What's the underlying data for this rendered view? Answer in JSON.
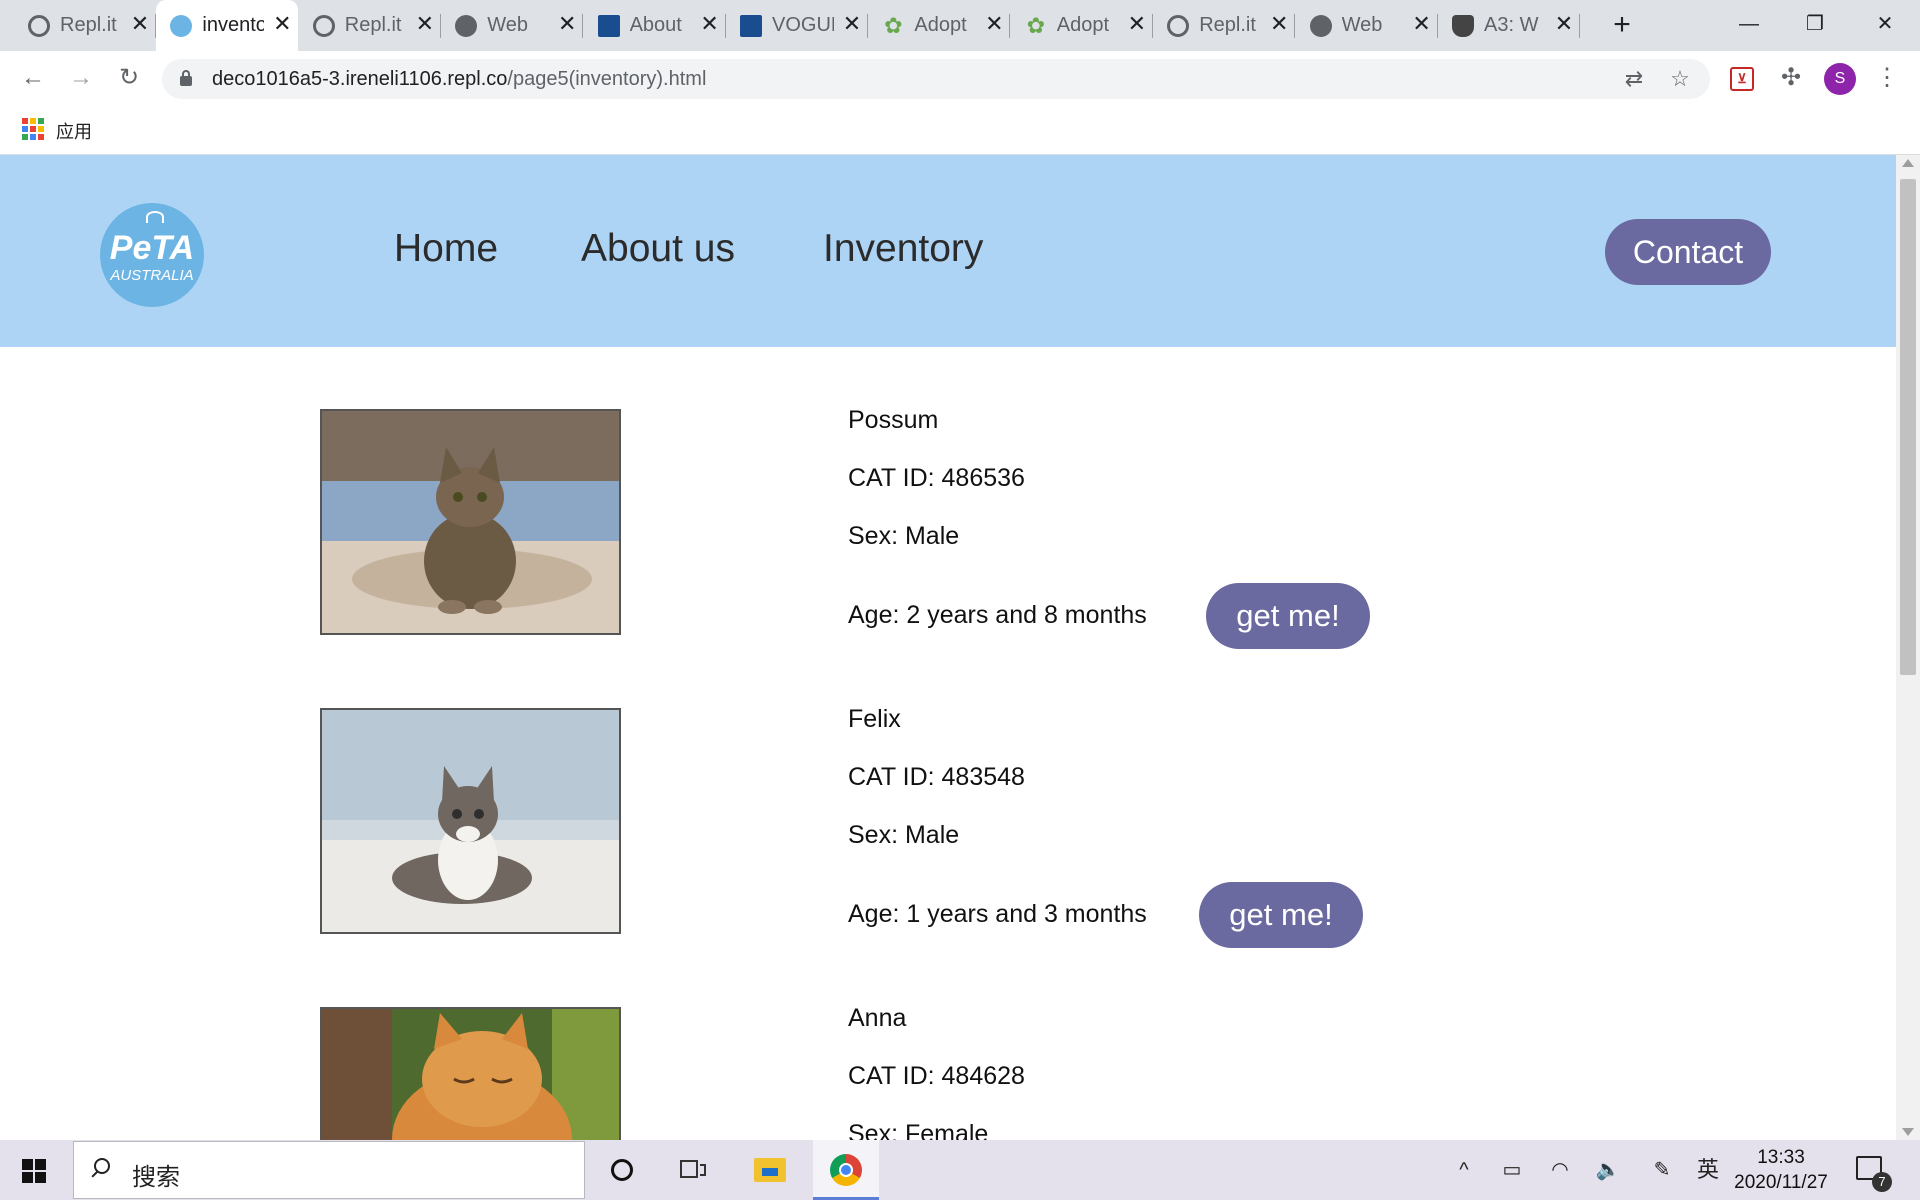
{
  "tabs": [
    {
      "title": "Repl.it",
      "favicon": "replit-icon",
      "active": false
    },
    {
      "title": "inventory",
      "favicon": "peta-favicon-icon",
      "active": true
    },
    {
      "title": "Repl.it",
      "favicon": "replit-icon",
      "active": false
    },
    {
      "title": "Web",
      "favicon": "globe-icon",
      "active": false
    },
    {
      "title": "About",
      "favicon": "vogue-icon",
      "active": false
    },
    {
      "title": "VOGUE",
      "favicon": "vogue-icon",
      "active": false
    },
    {
      "title": "Adopt",
      "favicon": "paw-icon",
      "active": false
    },
    {
      "title": "Adopt",
      "favicon": "paw-icon",
      "active": false
    },
    {
      "title": "Repl.it",
      "favicon": "replit-icon",
      "active": false
    },
    {
      "title": "Web",
      "favicon": "globe-icon",
      "active": false
    },
    {
      "title": "A3: W",
      "favicon": "shield-icon",
      "active": false
    }
  ],
  "tab_close_glyph": "✕",
  "new_tab_glyph": "+",
  "window_controls": {
    "minimize": "—",
    "restore": "❐",
    "close": "✕"
  },
  "toolbar": {
    "back_glyph": "←",
    "forward_glyph": "→",
    "reload_glyph": "↻",
    "url_host": "deco1016a5-3.ireneli1106.repl.co",
    "url_path": "/page5(inventory).html",
    "translate_glyph": "⇄",
    "bookmark_glyph": "☆",
    "extension_red_glyph": "⊻",
    "extensions_glyph": "✣",
    "avatar_letter": "S",
    "menu_glyph": "⋮"
  },
  "bookmarks": {
    "apps_label": "应用",
    "apps_colors": [
      "#ea4335",
      "#fbbc04",
      "#34a853",
      "#4285f4",
      "#ea4335",
      "#fbbc04",
      "#34a853",
      "#4285f4",
      "#ea4335"
    ]
  },
  "site": {
    "logo": {
      "line1": "PeTA",
      "line2": "AUSTRALIA"
    },
    "nav": [
      "Home",
      "About us",
      "Inventory"
    ],
    "contact_label": "Contact",
    "colors": {
      "hero": "#aed4f5",
      "button": "#6b6aa0"
    }
  },
  "cats": [
    {
      "name": "Possum",
      "id_line": "CAT ID: 486536",
      "sex_line": "Sex: Male",
      "age_line": "Age: 2 years and 8 months",
      "button": "get me!",
      "photo": "tabby-cat-photo"
    },
    {
      "name": "Felix",
      "id_line": "CAT ID: 483548",
      "sex_line": "Sex: Male",
      "age_line": "Age: 1 years and 3 months",
      "button": "get me!",
      "photo": "tabby-white-kitten-photo"
    },
    {
      "name": "Anna",
      "id_line": "CAT ID: 484628",
      "sex_line": "Sex: Female",
      "age_line": "",
      "button": "",
      "photo": "orange-cat-photo"
    }
  ],
  "taskbar": {
    "search_placeholder": "搜索",
    "tray": {
      "chevron": "^",
      "battery": "▭",
      "wifi": "◠",
      "volume": "🔈",
      "pen": "✎",
      "ime": "英"
    },
    "time": "13:33",
    "date": "2020/11/27",
    "notification_count": "7"
  }
}
